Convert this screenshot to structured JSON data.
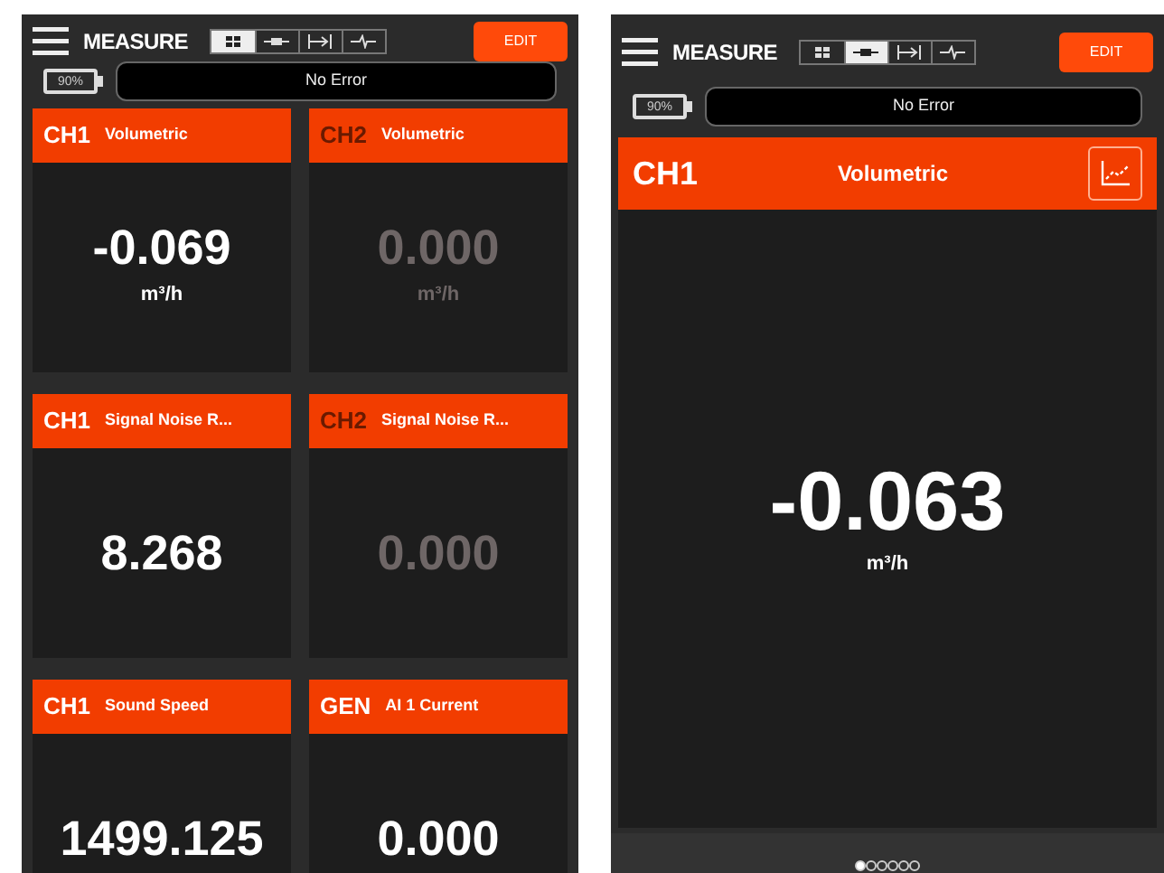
{
  "screens": [
    {
      "kind": "grid",
      "title": "MEASURE",
      "view_modes": [
        {
          "kind": "grid",
          "selected": true
        },
        {
          "kind": "single",
          "selected": false
        },
        {
          "kind": "split",
          "selected": false
        },
        {
          "kind": "wave",
          "selected": false
        }
      ],
      "edit_label": "EDIT",
      "battery": "90%",
      "status": "No Error",
      "tiles": [
        {
          "channel": "CH1",
          "label": "Volumetric",
          "value": "-0.069",
          "unit": "m³/h",
          "active": true
        },
        {
          "channel": "CH2",
          "label": "Volumetric",
          "value": "0.000",
          "unit": "m³/h",
          "active": false
        },
        {
          "channel": "CH1",
          "label": "Signal Noise R...",
          "value": "8.268",
          "active": true
        },
        {
          "channel": "CH2",
          "label": "Signal Noise R...",
          "value": "0.000",
          "active": false
        },
        {
          "channel": "CH1",
          "label": "Sound Speed",
          "value": "1499.125",
          "active": true
        },
        {
          "channel": "GEN",
          "label": "AI 1 Current",
          "value": "0.000",
          "active": true
        }
      ]
    },
    {
      "kind": "single",
      "title": "MEASURE",
      "view_modes": [
        {
          "kind": "grid",
          "selected": false
        },
        {
          "kind": "single",
          "selected": true
        },
        {
          "kind": "split",
          "selected": false
        },
        {
          "kind": "wave",
          "selected": false
        }
      ],
      "edit_label": "EDIT",
      "battery": "90%",
      "status": "No Error",
      "tiles": [
        {
          "channel": "CH1",
          "label": "Volumetric",
          "value": "-0.063",
          "unit": "m³/h",
          "active": true
        }
      ],
      "pages": [
        {
          "selected": true
        },
        {
          "selected": false
        },
        {
          "selected": false
        },
        {
          "selected": false
        },
        {
          "selected": false
        },
        {
          "selected": false
        }
      ]
    }
  ]
}
